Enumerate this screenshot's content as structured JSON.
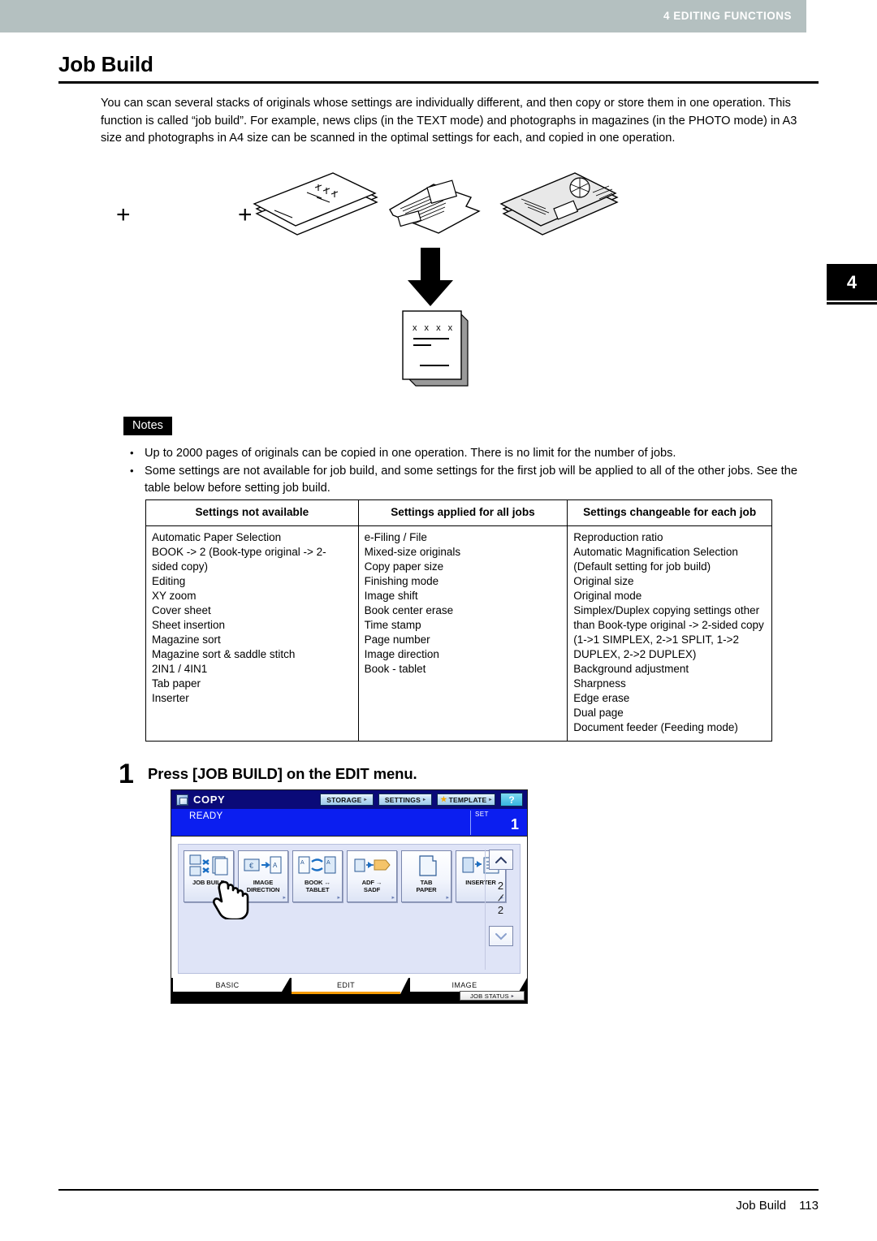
{
  "running_head": {
    "text": "4 EDITING FUNCTIONS",
    "band_color": "#b4c0c0"
  },
  "chapter_tab": {
    "number": "4"
  },
  "heading": "Job Build",
  "intro": "You can scan several stacks of originals whose settings are individually different, and then copy or store them in one operation. This function is called “job build”. For example, news clips (in the TEXT mode) and photographs in magazines (in the PHOTO mode) in A3 size and photographs in A4 size can be scanned in the optimal settings for each, and copied in one operation.",
  "illustration": {
    "plus_1": "+",
    "plus_2": "+",
    "output_marks": "x x x x"
  },
  "notes": {
    "badge": "Notes",
    "items": [
      "Up to 2000 pages of originals can be copied in one operation. There is no limit for the number of jobs.",
      "Some settings are not available for job build, and some settings for the first job will be applied to all of the other jobs. See the table below before setting job build."
    ]
  },
  "table": {
    "headers": [
      "Settings not available",
      "Settings applied for all jobs",
      "Settings changeable for each job"
    ],
    "columns": [
      [
        "Automatic Paper Selection",
        "BOOK -> 2 (Book-type original -> 2-sided copy)",
        "Editing",
        "XY zoom",
        "Cover sheet",
        "Sheet insertion",
        "Magazine sort",
        "Magazine sort & saddle stitch",
        "2IN1 / 4IN1",
        "Tab paper",
        "Inserter"
      ],
      [
        "e-Filing / File",
        "Mixed-size originals",
        "Copy paper size",
        "Finishing mode",
        "Image shift",
        "Book center erase",
        "Time stamp",
        "Page number",
        "Image direction",
        "Book - tablet"
      ],
      [
        "Reproduction ratio",
        "Automatic Magnification Selection (Default setting for job build)",
        "Original size",
        "Original mode",
        "Simplex/Duplex copying settings other than Book-type original -> 2-sided copy (1->1 SIMPLEX, 2->1 SPLIT, 1->2 DUPLEX, 2->2 DUPLEX)",
        "Background adjustment",
        "Sharpness",
        "Edge erase",
        "Dual page",
        "Document feeder (Feeding mode)"
      ]
    ]
  },
  "step": {
    "number": "1",
    "text": "Press [JOB BUILD] on the EDIT menu."
  },
  "lcd": {
    "title": "COPY",
    "toolbar": {
      "storage": "STORAGE",
      "settings": "SETTINGS",
      "template": "TEMPLATE",
      "help": "?",
      "arrow": "▸"
    },
    "status": "READY",
    "set_label": "SET",
    "set_value": "1",
    "buttons": [
      {
        "label_line1": "JOB BUILD",
        "label_line2": "",
        "icon": "job-build-icon",
        "has_arrow": false
      },
      {
        "label_line1": "IMAGE",
        "label_line2": "DIRECTION",
        "icon": "image-direction-icon",
        "has_arrow": true
      },
      {
        "label_line1": "BOOK ↔",
        "label_line2": "TABLET",
        "icon": "book-tablet-icon",
        "has_arrow": true
      },
      {
        "label_line1": "ADF →",
        "label_line2": "SADF",
        "icon": "adf-sadf-icon",
        "has_arrow": true
      },
      {
        "label_line1": "TAB",
        "label_line2": "PAPER",
        "icon": "tab-paper-icon",
        "has_arrow": true
      },
      {
        "label_line1": "INSERTER",
        "label_line2": "",
        "icon": "inserter-icon",
        "has_arrow": true
      }
    ],
    "scroll": {
      "up": "▲",
      "down": "▼",
      "page_current": "2",
      "page_sep": "/",
      "page_total": "2"
    },
    "tabs": [
      {
        "label": "BASIC",
        "active": false
      },
      {
        "label": "EDIT",
        "active": true
      },
      {
        "label": "IMAGE",
        "active": false
      }
    ],
    "job_status": "JOB STATUS",
    "accent_color": "#f59b00",
    "titlebar_color": "#0a0a78",
    "status_color": "#0b1ef0"
  },
  "footer": {
    "title": "Job Build",
    "page": "113"
  }
}
